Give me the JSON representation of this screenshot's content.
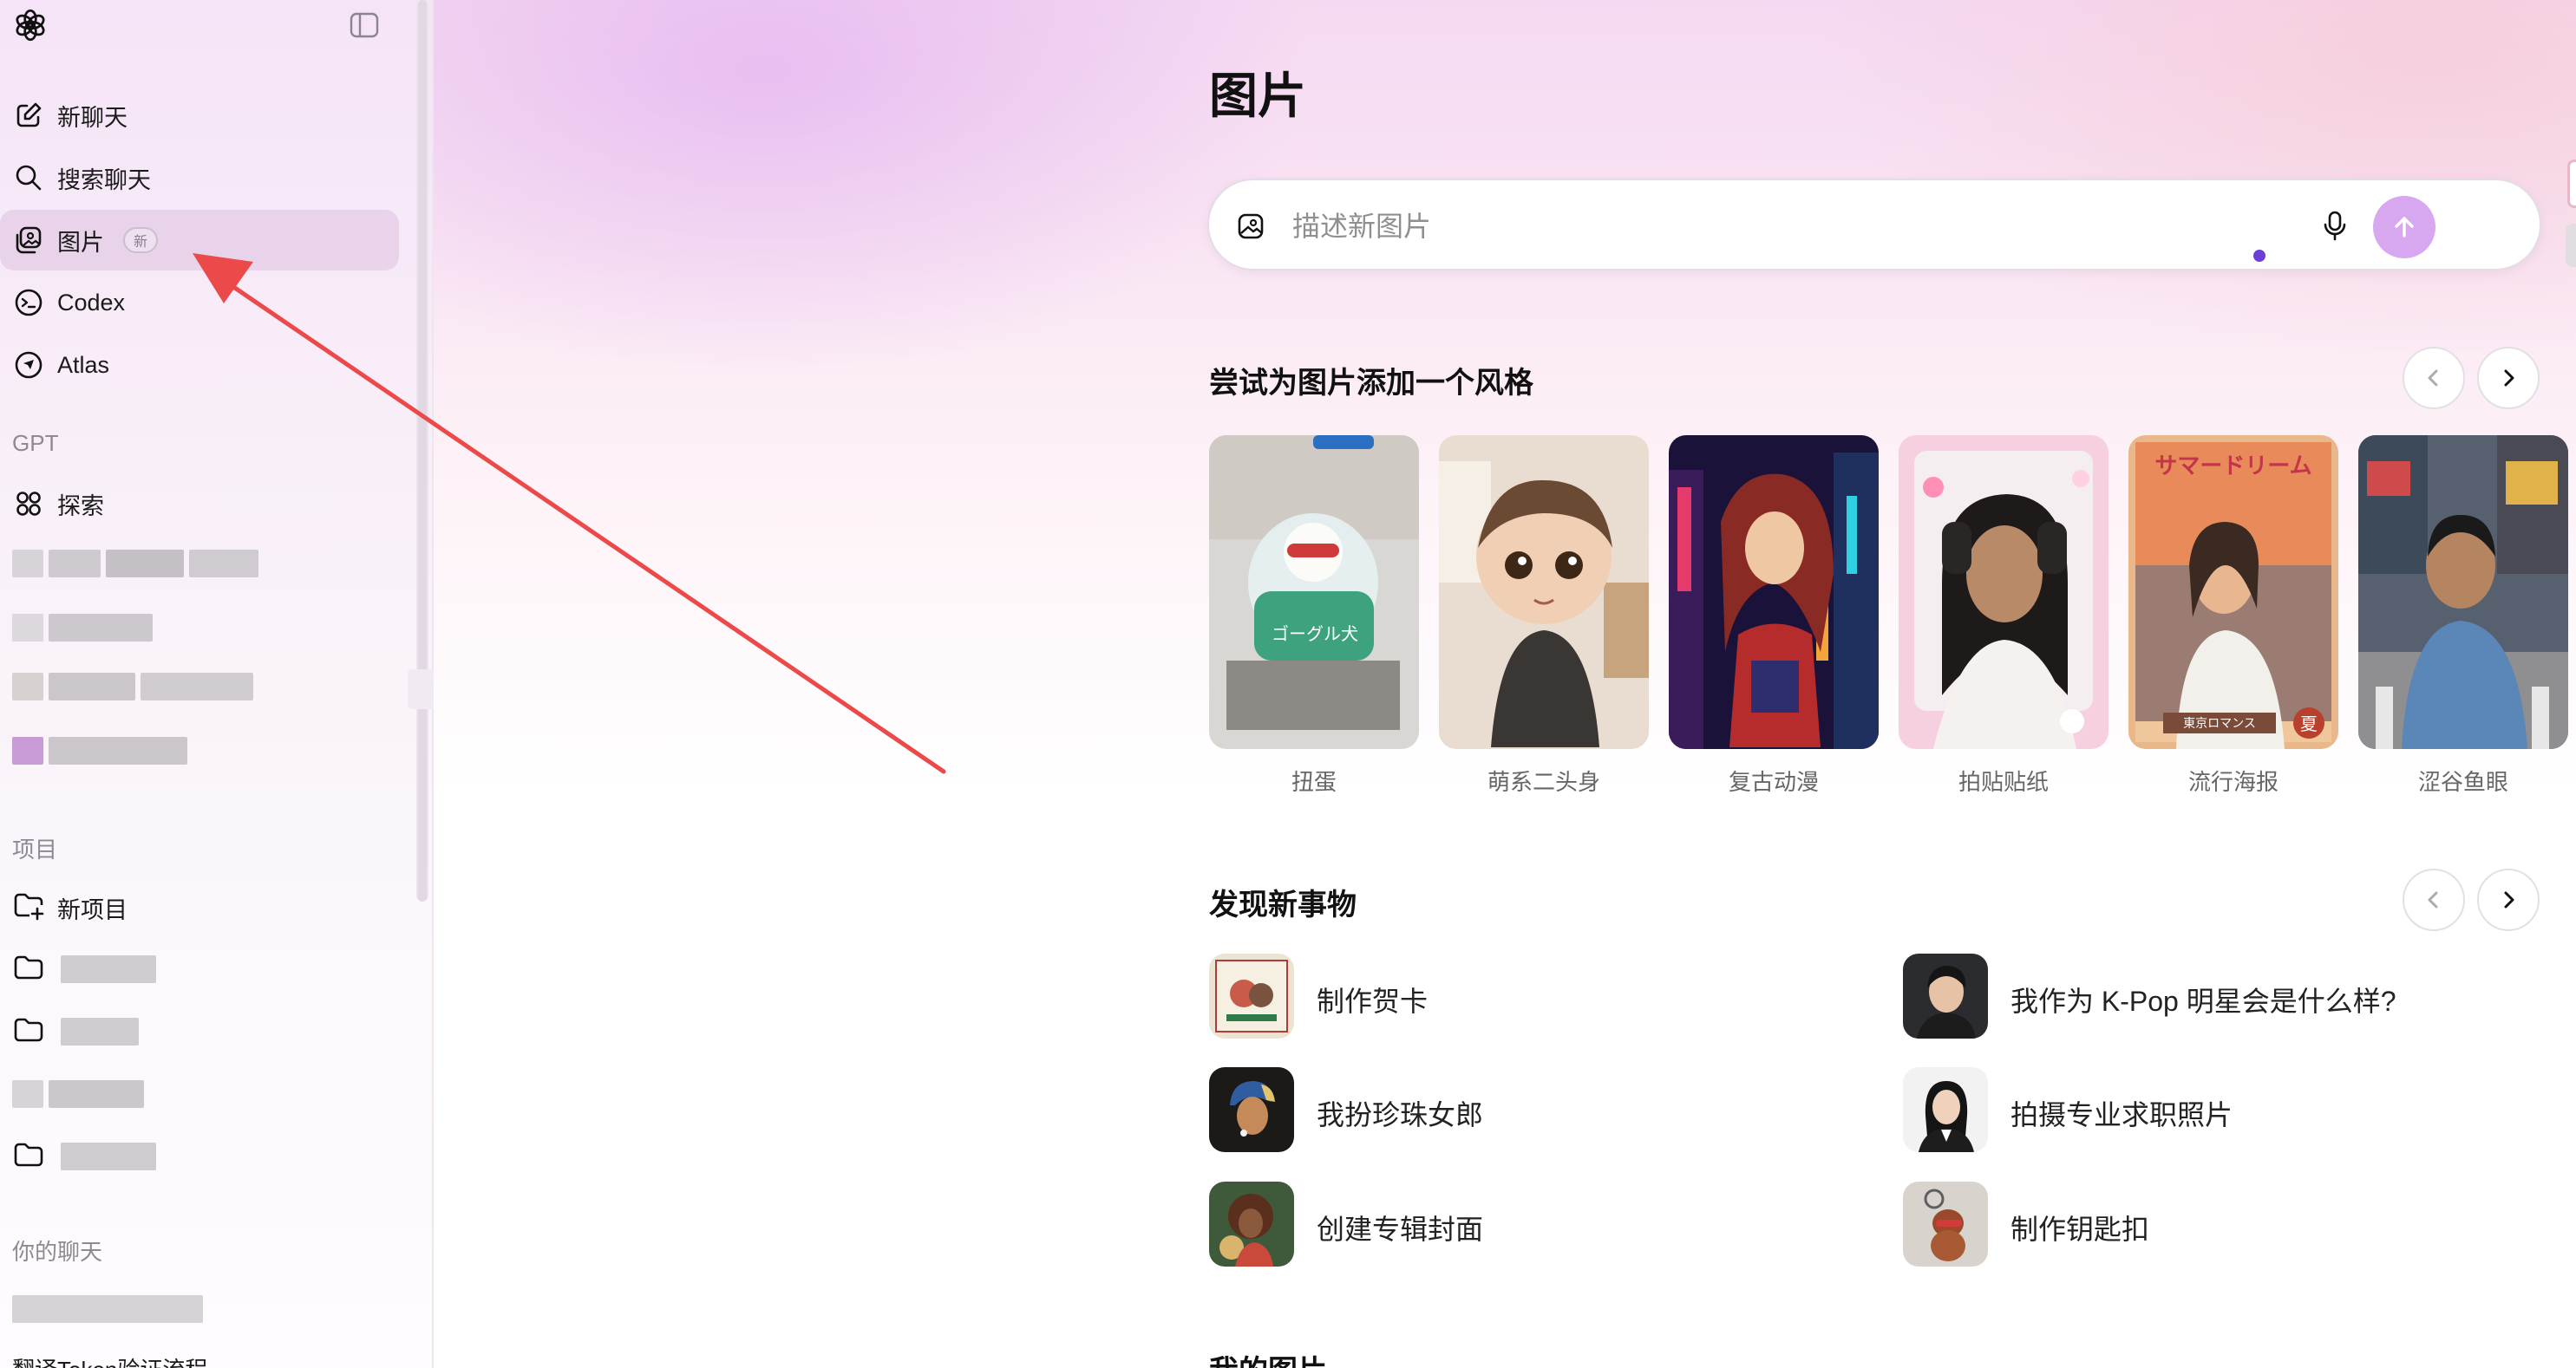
{
  "sidebar": {
    "nav": [
      {
        "label": "新聊天",
        "icon": "edit-icon"
      },
      {
        "label": "搜索聊天",
        "icon": "search-icon"
      },
      {
        "label": "图片",
        "icon": "images-icon",
        "badge": "新"
      },
      {
        "label": "Codex",
        "icon": "codex-icon"
      },
      {
        "label": "Atlas",
        "icon": "atlas-icon"
      }
    ],
    "gpt_section": "GPT",
    "explore_label": "探索",
    "projects_section": "项目",
    "new_project_label": "新项目",
    "chats_section": "你的聊天",
    "bottom_chat": "翻译Token验证流程"
  },
  "main": {
    "title": "图片",
    "prompt_placeholder": "描述新图片",
    "styles_title": "尝试为图片添加一个风格",
    "styles": [
      {
        "label": "扭蛋"
      },
      {
        "label": "萌系二头身"
      },
      {
        "label": "复古动漫"
      },
      {
        "label": "拍贴贴纸"
      },
      {
        "label": "流行海报"
      },
      {
        "label": "涩谷鱼眼"
      }
    ],
    "discover_title": "发现新事物",
    "discover": [
      {
        "label": "制作贺卡"
      },
      {
        "label": "我作为 K-Pop 明星会是什么样?"
      },
      {
        "label": "我扮珍珠女郎"
      },
      {
        "label": "拍摄专业求职照片"
      },
      {
        "label": "创建专辑封面"
      },
      {
        "label": "制作钥匙扣"
      }
    ],
    "my_images_title": "我的图片"
  },
  "colors": {
    "accent_send": "#d7a8f0",
    "annotation_arrow": "#ec4a4a",
    "active_item_bg": "#e7d2e8"
  }
}
